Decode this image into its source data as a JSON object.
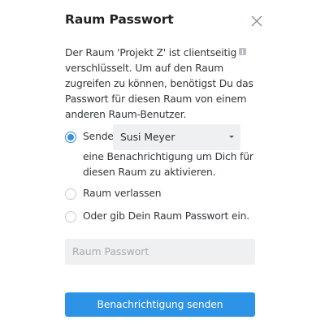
{
  "dialog": {
    "title": "Raum Passwort",
    "close_icon": "close-icon",
    "description_part1": "Der Raum 'Projekt Z' ist clientseitig",
    "info_icon": "info-icon",
    "description_part2": "verschlüsselt. Um auf den Raum zugreifen zu können, benötigst Du das Passwort für diesen Raum von einem anderen Raum-Benutzer."
  },
  "options": {
    "send": {
      "label": "Sende",
      "checked": true,
      "select_value": "Susi Meyer",
      "sub_text": "eine Benachrichtigung um Dich für diesen Raum zu aktivieren."
    },
    "leave": {
      "label": "Raum verlassen",
      "checked": false
    },
    "password": {
      "label": "Oder gib Dein Raum Passwort ein.",
      "checked": false
    }
  },
  "password_input": {
    "placeholder": "Raum Passwort",
    "value": ""
  },
  "submit_button": {
    "label": "Benachrichtigung senden"
  },
  "colors": {
    "accent": "#2d93e6",
    "field_bg": "#eef0f2"
  }
}
